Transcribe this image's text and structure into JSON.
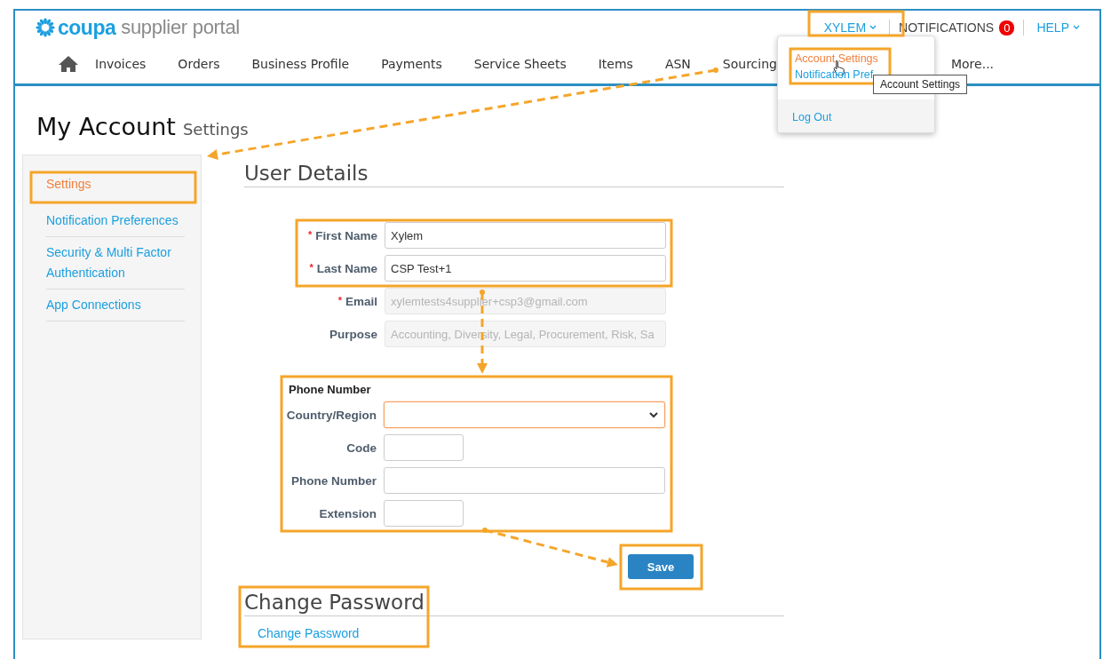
{
  "header": {
    "logo": {
      "brand": "coupa",
      "product": "supplier portal"
    },
    "user_menu": {
      "label": "XYLEM",
      "expanded": true
    },
    "notifications": {
      "label": "NOTIFICATIONS",
      "count": "0"
    },
    "help": {
      "label": "HELP"
    }
  },
  "nav": {
    "items": [
      {
        "label": "Invoices"
      },
      {
        "label": "Orders"
      },
      {
        "label": "Business Profile"
      },
      {
        "label": "Payments"
      },
      {
        "label": "Service Sheets"
      },
      {
        "label": "Items"
      },
      {
        "label": "ASN"
      },
      {
        "label": "Sourcing"
      }
    ],
    "more": "More..."
  },
  "user_dropdown": {
    "items": [
      {
        "label": "Account Settings",
        "selected": true
      },
      {
        "label": "Notification Pref",
        "selected": false
      }
    ],
    "logout": "Log Out",
    "tooltip": "Account Settings"
  },
  "page_title": {
    "title": "My Account",
    "subtitle": "Settings"
  },
  "sidebar": {
    "items": [
      {
        "label": "Settings",
        "selected": true
      },
      {
        "label": "Notification Preferences",
        "selected": false
      },
      {
        "label": "Security & Multi Factor Authentication",
        "selected": false
      },
      {
        "label": "App Connections",
        "selected": false
      }
    ]
  },
  "user_details": {
    "heading": "User Details",
    "required_mark": "*",
    "fields": [
      {
        "label": "First Name",
        "required": true,
        "value": "Xylem",
        "disabled": false
      },
      {
        "label": "Last Name",
        "required": true,
        "value": "CSP Test+1",
        "disabled": false
      },
      {
        "label": "Email",
        "required": true,
        "value": "xylemtests4supplier+csp3@gmail.com",
        "disabled": true
      },
      {
        "label": "Purpose",
        "required": false,
        "value": "Accounting, Diversity, Legal, Procurement, Risk, Sa",
        "disabled": true
      }
    ]
  },
  "phone_number": {
    "heading": "Phone Number",
    "fields": [
      {
        "label": "Country/Region",
        "kind": "select",
        "focused": true
      },
      {
        "label": "Code",
        "kind": "short",
        "focused": false
      },
      {
        "label": "Phone Number",
        "kind": "text",
        "focused": false
      },
      {
        "label": "Extension",
        "kind": "short",
        "focused": false
      }
    ]
  },
  "save_button": "Save",
  "change_password": {
    "heading": "Change Password",
    "link": "Change Password"
  }
}
